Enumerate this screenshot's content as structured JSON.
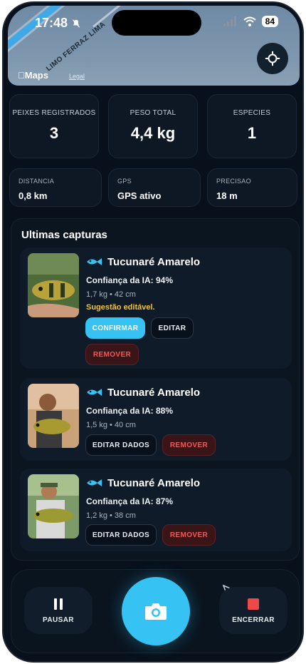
{
  "status_bar": {
    "time": "17:48",
    "battery": "84"
  },
  "map": {
    "street": "LIMO FERRAZ LIMA",
    "logo": "Maps",
    "legal": "Legal"
  },
  "stats": [
    {
      "label": "PEIXES REGISTRADOS",
      "value": "3"
    },
    {
      "label": "PESO TOTAL",
      "value": "4,4 kg"
    },
    {
      "label": "ESPECIES",
      "value": "1"
    }
  ],
  "info": [
    {
      "label": "DISTANCIA",
      "value": "0,8 km"
    },
    {
      "label": "GPS",
      "value": "GPS ativo"
    },
    {
      "label": "PRECISAO",
      "value": "18 m"
    }
  ],
  "captures": {
    "title": "Ultimas capturas",
    "items": [
      {
        "name": "Tucunaré Amarelo",
        "confidence": "Confiança da IA: 94%",
        "meta": "1,7 kg • 42 cm",
        "hint": "Sugestão editável.",
        "confirm_label": "CONFIRMAR",
        "edit_label": "EDITAR",
        "remove_label": "REMOVER"
      },
      {
        "name": "Tucunaré Amarelo",
        "confidence": "Confiança da IA: 88%",
        "meta": "1,5 kg • 40 cm",
        "edit_label": "EDITAR DADOS",
        "remove_label": "REMOVER"
      },
      {
        "name": "Tucunaré Amarelo",
        "confidence": "Confiança da IA: 87%",
        "meta": "1,2 kg • 38 cm",
        "edit_label": "EDITAR DADOS",
        "remove_label": "REMOVER"
      }
    ]
  },
  "bottom_bar": {
    "pause_label": "PAUSAR",
    "end_label": "ENCERRAR"
  },
  "colors": {
    "accent": "#36c2f2",
    "danger": "#ef5a5a",
    "warning": "#f2c23a",
    "background": "#07101b"
  },
  "icons": [
    "locate-icon",
    "fish-icon",
    "pause-icon",
    "camera-icon",
    "stop-icon",
    "cursor-icon",
    "wifi-icon",
    "signal-icon",
    "mute-bell-icon"
  ]
}
